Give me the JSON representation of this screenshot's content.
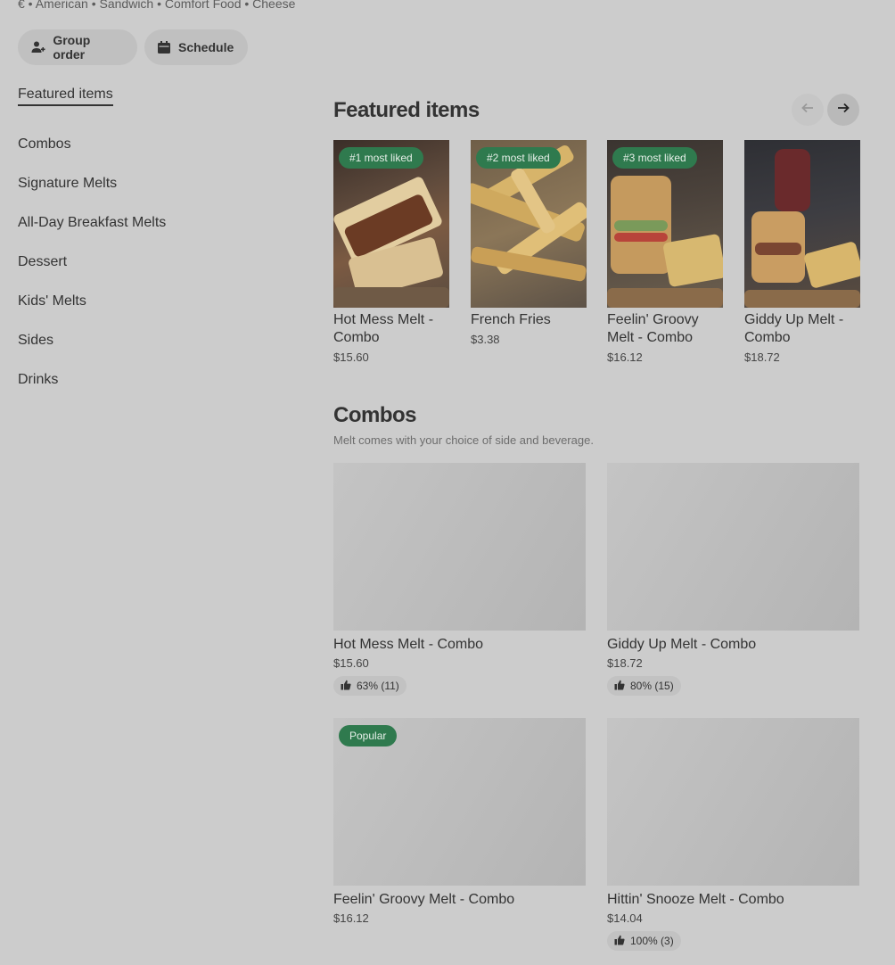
{
  "meta": "€ • American • Sandwich • Comfort Food • Cheese",
  "buttons": {
    "group_order": "Group order",
    "schedule": "Schedule"
  },
  "nav": [
    {
      "label": "Featured items"
    },
    {
      "label": "Combos"
    },
    {
      "label": "Signature Melts"
    },
    {
      "label": "All-Day Breakfast Melts"
    },
    {
      "label": "Dessert"
    },
    {
      "label": "Kids' Melts"
    },
    {
      "label": "Sides"
    },
    {
      "label": "Drinks"
    }
  ],
  "featured": {
    "title": "Featured items",
    "items": [
      {
        "badge": "#1 most liked",
        "name": "Hot Mess Melt - Combo",
        "price": "$15.60"
      },
      {
        "badge": "#2 most liked",
        "name": "French Fries",
        "price": "$3.38"
      },
      {
        "badge": "#3 most liked",
        "name": "Feelin' Groovy Melt - Combo",
        "price": "$16.12"
      },
      {
        "badge": "",
        "name": "Giddy Up Melt - Combo",
        "price": "$18.72"
      }
    ]
  },
  "combos": {
    "title": "Combos",
    "subtitle": "Melt comes with your choice of side and beverage.",
    "items": [
      {
        "name": "Hot Mess Melt - Combo",
        "price": "$15.60",
        "rating": "63% (11)",
        "badge": ""
      },
      {
        "name": "Giddy Up Melt - Combo",
        "price": "$18.72",
        "rating": "80% (15)",
        "badge": ""
      },
      {
        "name": "Feelin' Groovy Melt - Combo",
        "price": "$16.12",
        "rating": "",
        "badge": "Popular"
      },
      {
        "name": "Hittin' Snooze Melt - Combo",
        "price": "$14.04",
        "rating": "100% (3)",
        "badge": ""
      }
    ]
  },
  "colors": {
    "overlay_bg": "#cccccc",
    "badge_green": "#2f7a4e"
  },
  "icons": {
    "group_order": "add-person-icon",
    "schedule": "calendar-icon",
    "prev": "arrow-left-icon",
    "next": "arrow-right-icon",
    "thumb": "thumbs-up-icon"
  }
}
